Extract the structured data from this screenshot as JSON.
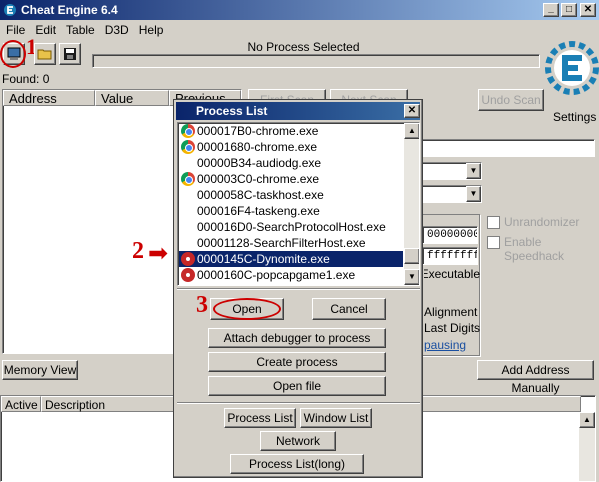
{
  "window": {
    "title": "Cheat Engine 6.4",
    "controls": {
      "minimize": "_",
      "maximize": "□",
      "close": "✕"
    }
  },
  "menu": [
    "File",
    "Edit",
    "Table",
    "D3D",
    "Help"
  ],
  "process_label": "No Process Selected",
  "found_label": "Found: 0",
  "results_columns": [
    "Address",
    "Value",
    "Previous"
  ],
  "scan": {
    "first_scan": "First Scan",
    "next_scan": "Next Scan",
    "undo_scan": "Undo Scan"
  },
  "settings_label": "Settings",
  "right_panel": {
    "hex_value_1": "00000000",
    "hex_value_2": "ffffffff",
    "executable_label": "Executable",
    "alignment_label": "Alignment",
    "last_digits_label": "Last Digits",
    "pausing_label": "pausing",
    "unrandomizer_label": "Unrandomizer",
    "speedhack_label": "Enable Speedhack"
  },
  "bottom": {
    "memory_view": "Memory View",
    "add_address_manually": "Add Address Manually",
    "columns": [
      "Active",
      "Description"
    ]
  },
  "annotations": {
    "step1": "1",
    "step2": "2",
    "step3": "3",
    "arrow": "➡"
  },
  "process_dialog": {
    "title": "Process List",
    "close": "✕",
    "processes": [
      {
        "name": "000017B0-chrome.exe",
        "icon": "chrome"
      },
      {
        "name": "00001680-chrome.exe",
        "icon": "chrome"
      },
      {
        "name": "00000B34-audiodg.exe",
        "icon": "none"
      },
      {
        "name": "000003C0-chrome.exe",
        "icon": "chrome"
      },
      {
        "name": "0000058C-taskhost.exe",
        "icon": "none"
      },
      {
        "name": "000016F4-taskeng.exe",
        "icon": "none"
      },
      {
        "name": "000016D0-SearchProtocolHost.exe",
        "icon": "none"
      },
      {
        "name": "00001128-SearchFilterHost.exe",
        "icon": "none"
      },
      {
        "name": "0000145C-Dynomite.exe",
        "icon": "dynomite",
        "selected": true
      },
      {
        "name": "0000160C-popcapgame1.exe",
        "icon": "dynomite"
      }
    ],
    "buttons": {
      "open": "Open",
      "cancel": "Cancel",
      "attach_debugger": "Attach debugger to process",
      "create_process": "Create process",
      "open_file": "Open file",
      "process_list": "Process List",
      "window_list": "Window List",
      "network": "Network",
      "process_list_long": "Process List(long)"
    }
  },
  "colors": {
    "selection": "#0a246a",
    "annotation_red": "#cc0000",
    "logo_blue": "#1a7fb5"
  }
}
